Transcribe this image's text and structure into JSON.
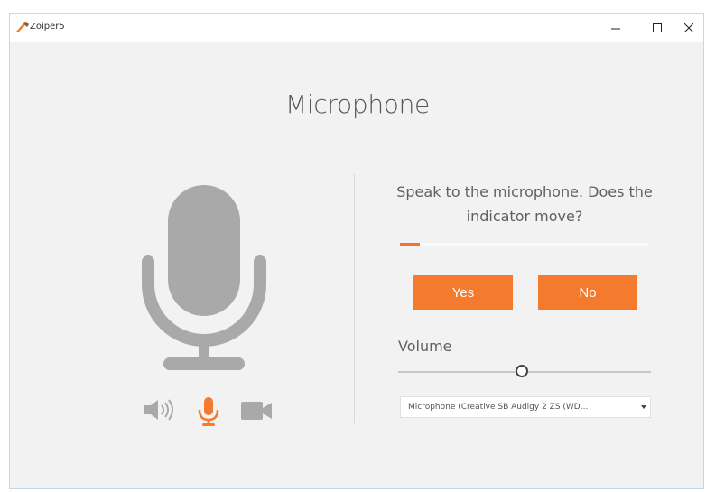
{
  "window": {
    "title": "Zoiper5",
    "controls": {
      "minimize": "–",
      "maximize": "☐",
      "close": "✕"
    }
  },
  "main": {
    "heading": "Microphone",
    "prompt": "Speak to the microphone. Does the indicator move?",
    "input_level": 0.08,
    "yes_label": "Yes",
    "no_label": "No",
    "volume_label": "Volume",
    "volume_level": 0.49,
    "device_selected": "Microphone (Creative SB Audigy 2 ZS (WD..."
  },
  "device_icons": [
    {
      "name": "speaker-icon",
      "active": false
    },
    {
      "name": "microphone-icon",
      "active": true
    },
    {
      "name": "camera-icon",
      "active": false
    }
  ],
  "colors": {
    "accent": "#f47a2e",
    "inactive_icon": "#a9a9a9",
    "background": "#f2f2f2"
  }
}
